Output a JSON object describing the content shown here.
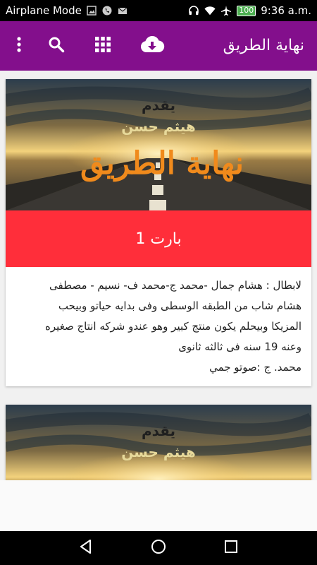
{
  "status_bar": {
    "carrier": "Airplane Mode",
    "battery": "100",
    "time": "9:36 a.m.",
    "icons": [
      "image-icon",
      "phone-icon",
      "mail-icon",
      "headphones-icon",
      "wifi-icon",
      "airplane-icon"
    ]
  },
  "app_bar": {
    "title": "نهاية الطريق",
    "background": "#830f8c",
    "icons": [
      "more-vert-icon",
      "search-icon",
      "grid-icon",
      "cloud-download-icon"
    ]
  },
  "cards": [
    {
      "image_text": [
        "يقدم",
        "هيثم حسن",
        "نهاية الطريق"
      ],
      "banner": "بارت 1",
      "banner_color": "#ff2e3a",
      "lines": [
        "لابطال : هشام جمال -محمد ج-محمد ف- نسيم - مصطفى",
        "هشام شاب من الطبقه الوسطى وفى بدايه حياتو وبيحب",
        "المزيكا وبيحلم يكون منتج كبير وهو عندو شركه انتاج صغيره",
        "وعنه 19 سنه فى ثالثه ثانوى",
        "محمد. ج :صوتو جمي"
      ]
    },
    {
      "image_text": [
        "يقدم",
        "هيثم حسن"
      ]
    }
  ],
  "nav_bar": {
    "icons": [
      "back-icon",
      "home-icon",
      "recents-icon"
    ]
  }
}
